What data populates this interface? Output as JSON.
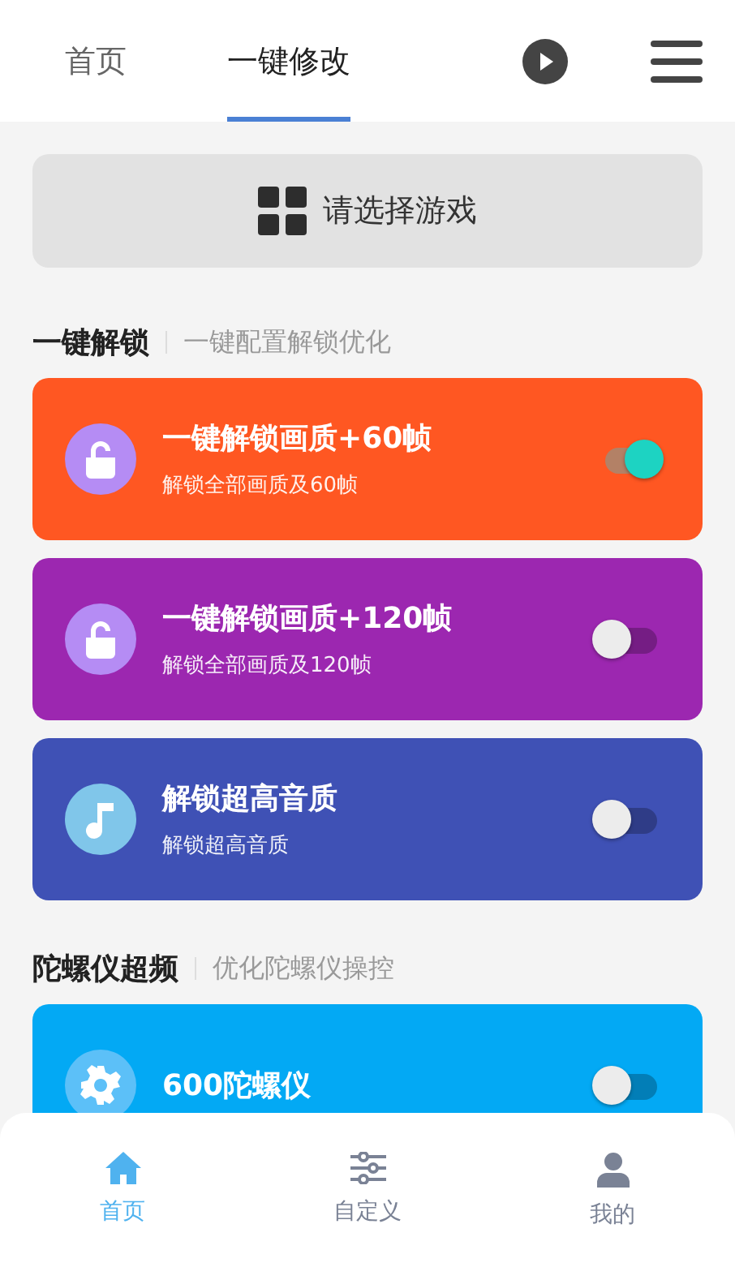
{
  "tabs": [
    {
      "label": "首页",
      "selected": false
    },
    {
      "label": "一键修改",
      "selected": true
    }
  ],
  "game_picker": {
    "label": "请选择游戏"
  },
  "sections": [
    {
      "title": "一键解锁",
      "subtitle": "一键配置解锁优化",
      "items": [
        {
          "kind": "lock",
          "color": "#ff5722",
          "title": "一键解锁画质+60帧",
          "subtitle": "解锁全部画质及60帧",
          "on": true
        },
        {
          "kind": "lock",
          "color": "#9c27b0",
          "title": "一键解锁画质+120帧",
          "subtitle": "解锁全部画质及120帧",
          "on": false
        },
        {
          "kind": "music",
          "color": "#3f51b5",
          "title": "解锁超高音质",
          "subtitle": "解锁超高音质",
          "on": false
        }
      ]
    },
    {
      "title": "陀螺仪超频",
      "subtitle": "优化陀螺仪操控",
      "items": [
        {
          "kind": "gear",
          "color": "#03a9f4",
          "title": "600陀螺仪",
          "on": false
        }
      ]
    }
  ],
  "bottom_nav": [
    {
      "kind": "home",
      "label": "首页",
      "selected": true
    },
    {
      "kind": "sliders",
      "label": "自定义",
      "selected": false
    },
    {
      "kind": "person",
      "label": "我的",
      "selected": false
    }
  ]
}
